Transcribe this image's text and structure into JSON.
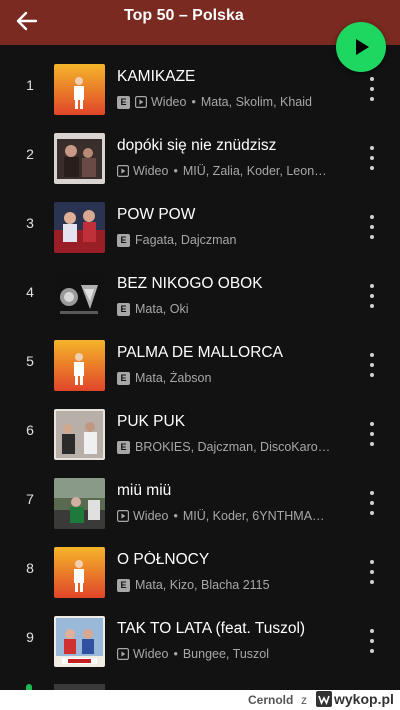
{
  "header": {
    "title": "Top 50 – Polska",
    "back_icon": "arrow-left-icon",
    "play_icon": "play-icon",
    "accent_color": "#1ed760"
  },
  "tracks": [
    {
      "rank": "1",
      "title": "KAMIKAZE",
      "explicit": true,
      "video": true,
      "video_label": "Wideo",
      "artists": "Mata, Skolim, Khaid",
      "cover": "orange"
    },
    {
      "rank": "2",
      "title": "dopóki się nie znüdzisz",
      "explicit": false,
      "video": true,
      "video_label": "Wideo",
      "artists": "MIÜ, Zalia, Koder, Leon…",
      "cover": "photo-people"
    },
    {
      "rank": "3",
      "title": "POW POW",
      "explicit": true,
      "video": false,
      "video_label": "",
      "artists": "Fagata, Dajczman",
      "cover": "photo-red"
    },
    {
      "rank": "4",
      "title": "BEZ NIKOGO OBOK",
      "explicit": true,
      "video": false,
      "video_label": "",
      "artists": "Mata, Oki",
      "cover": "dark-chrome"
    },
    {
      "rank": "5",
      "title": "PALMA DE MALLORCA",
      "explicit": true,
      "video": false,
      "video_label": "",
      "artists": "Mata, Żabson",
      "cover": "orange"
    },
    {
      "rank": "6",
      "title": "PUK PUK",
      "explicit": true,
      "video": false,
      "video_label": "",
      "artists": "BROKIES, Dajczman, DiscoKaro…",
      "cover": "photo-room"
    },
    {
      "rank": "7",
      "title": "miü miü",
      "explicit": false,
      "video": true,
      "video_label": "Wideo",
      "artists": "MIÜ, Koder, 6YNTHMA…",
      "cover": "photo-street"
    },
    {
      "rank": "8",
      "title": "O PÓŁNOCY",
      "explicit": true,
      "video": false,
      "video_label": "",
      "artists": "Mata, Kizo, Blacha 2115",
      "cover": "orange"
    },
    {
      "rank": "9",
      "title": "TAK TO LATA (feat. Tuszol)",
      "explicit": false,
      "video": true,
      "video_label": "Wideo",
      "artists": "Bungee, Tuszol",
      "cover": "photo-poster"
    }
  ],
  "footer": {
    "username": "Cernold",
    "z_label": "z",
    "site": "wykop.pl"
  }
}
